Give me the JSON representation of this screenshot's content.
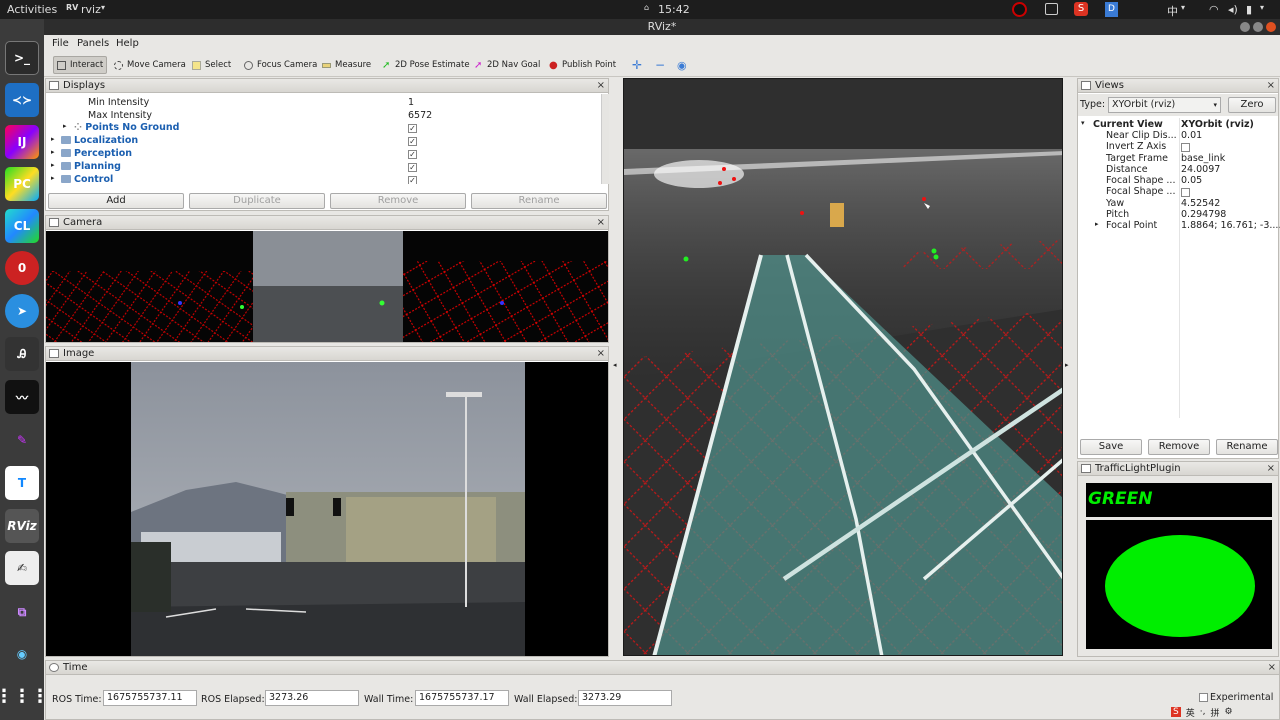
{
  "topbar": {
    "activities": "Activities",
    "app": "rviz",
    "clock": "15:42",
    "ime": "中"
  },
  "window": {
    "title": "RViz*"
  },
  "menu": [
    "File",
    "Panels",
    "Help"
  ],
  "toolbar": [
    "Interact",
    "Move Camera",
    "Select",
    "Focus Camera",
    "Measure",
    "2D Pose Estimate",
    "2D Nav Goal",
    "Publish Point"
  ],
  "displays": {
    "title": "Displays",
    "rows": [
      {
        "name": "Min Intensity",
        "value": "1"
      },
      {
        "name": "Max Intensity",
        "value": "6572"
      }
    ],
    "groups": [
      {
        "name": "Points No Ground",
        "checked": "✓"
      },
      {
        "name": "Localization",
        "checked": "✓"
      },
      {
        "name": "Perception",
        "checked": "✓"
      },
      {
        "name": "Planning",
        "checked": "✓"
      },
      {
        "name": "Control",
        "checked": "✓"
      }
    ],
    "buttons": {
      "add": "Add",
      "duplicate": "Duplicate",
      "remove": "Remove",
      "rename": "Rename"
    }
  },
  "camera_panel": {
    "title": "Camera"
  },
  "image_panel": {
    "title": "Image"
  },
  "views": {
    "title": "Views",
    "type_label": "Type:",
    "type_value": "XYOrbit (rviz)",
    "zero": "Zero",
    "current_view": "Current View",
    "current_value": "XYOrbit (rviz)",
    "props": [
      {
        "name": "Near Clip Dis...",
        "value": "0.01"
      },
      {
        "name": "Invert Z Axis",
        "value": ""
      },
      {
        "name": "Target Frame",
        "value": "base_link"
      },
      {
        "name": "Distance",
        "value": "24.0097"
      },
      {
        "name": "Focal Shape ...",
        "value": "0.05"
      },
      {
        "name": "Focal Shape ...",
        "value": ""
      },
      {
        "name": "Yaw",
        "value": "4.52542"
      },
      {
        "name": "Pitch",
        "value": "0.294798"
      },
      {
        "name": "Focal Point",
        "value": "1.8864; 16.761; -3...."
      }
    ],
    "buttons": {
      "save": "Save",
      "remove": "Remove",
      "rename": "Rename"
    }
  },
  "traffic": {
    "title": "TrafficLightPlugin",
    "state": "GREEN",
    "color": "#00ee00"
  },
  "time": {
    "title": "Time",
    "ros_time_label": "ROS Time:",
    "ros_time": "1675755737.11",
    "ros_elapsed_label": "ROS Elapsed:",
    "ros_elapsed": "3273.26",
    "wall_time_label": "Wall Time:",
    "wall_time": "1675755737.17",
    "wall_elapsed_label": "Wall Elapsed:",
    "wall_elapsed": "3273.29",
    "experimental": "Experimental"
  },
  "dock_apps": [
    "terminal-icon",
    "vscode-icon",
    "intellij-icon",
    "pycharm-icon",
    "clion-icon",
    "security-icon",
    "messenger-icon",
    "reader-icon",
    "wave-icon",
    "brush-icon",
    "todesk-icon",
    "rviz-icon",
    "notes-icon",
    "network-icon",
    "shell-icon",
    "app-grid-icon"
  ]
}
